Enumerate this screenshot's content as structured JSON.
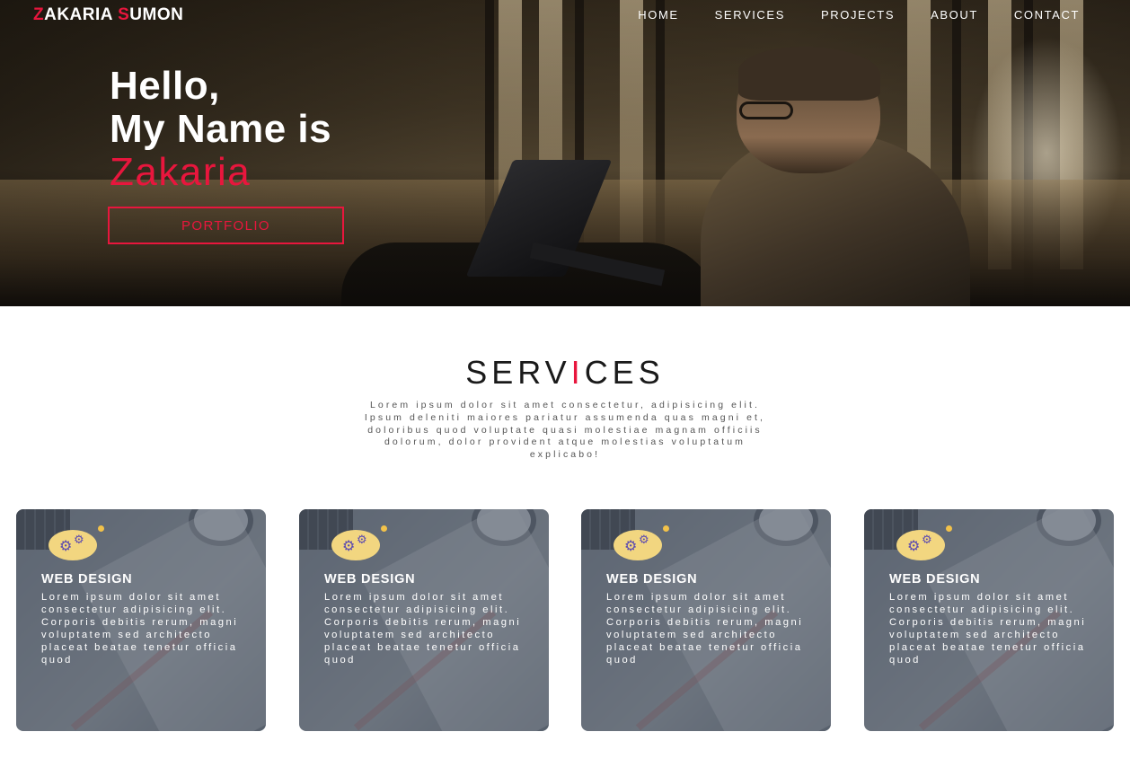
{
  "brand": {
    "first_initial": "Z",
    "first_rest": "AKARIA ",
    "last_initial": "S",
    "last_rest": "UMON"
  },
  "nav": {
    "items": [
      "HOME",
      "SERVICES",
      "PROJECTS",
      "ABOUT",
      "CONTACT"
    ]
  },
  "hero": {
    "line1": "Hello,",
    "line2": "My Name is",
    "name": "Zakaria",
    "button": "PORTFOLIO"
  },
  "services": {
    "title_part1": "SERV",
    "title_accent": "I",
    "title_part2": "CES",
    "description": "Lorem ipsum dolor sit amet consectetur, adipisicing elit. Ipsum deleniti maiores pariatur assumenda quas magni et, doloribus quod voluptate quasi molestiae magnam officiis dolorum, dolor provident atque molestias voluptatum explicabo!",
    "cards": [
      {
        "title": "WEB DESIGN",
        "text": "Lorem ipsum dolor sit amet consectetur adipisicing elit. Corporis debitis rerum, magni voluptatem sed architecto placeat beatae tenetur officia quod",
        "icon": "gears-icon"
      },
      {
        "title": "WEB DESIGN",
        "text": "Lorem ipsum dolor sit amet consectetur adipisicing elit. Corporis debitis rerum, magni voluptatem sed architecto placeat beatae tenetur officia quod",
        "icon": "gears-icon"
      },
      {
        "title": "WEB DESIGN",
        "text": "Lorem ipsum dolor sit amet consectetur adipisicing elit. Corporis debitis rerum, magni voluptatem sed architecto placeat beatae tenetur officia quod",
        "icon": "gears-icon"
      },
      {
        "title": "WEB DESIGN",
        "text": "Lorem ipsum dolor sit amet consectetur adipisicing elit. Corporis debitis rerum, magni voluptatem sed architecto placeat beatae tenetur officia quod",
        "icon": "gears-icon"
      }
    ]
  },
  "colors": {
    "accent": "#e8163d",
    "text_dark": "#1a1a1a",
    "text_muted": "#555555"
  }
}
